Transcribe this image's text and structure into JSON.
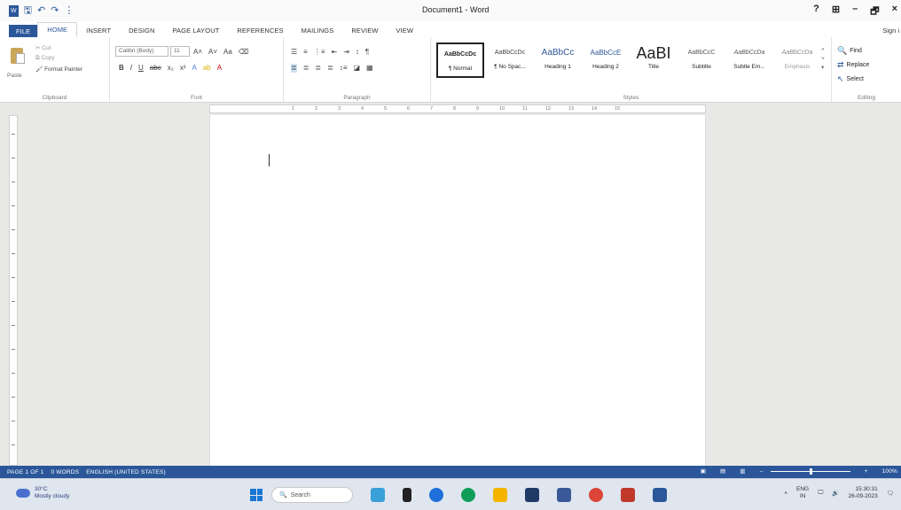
{
  "window": {
    "title": "Document1 - Word"
  },
  "qat": {
    "save": "🖫",
    "undo": "↶",
    "redo": "↷",
    "more": "⋮"
  },
  "window_controls": {
    "help": "?",
    "ribbon_opts": "⊞",
    "minimize": "–",
    "maximize": "🗗",
    "close": "×"
  },
  "signin": "Sign i",
  "tabs": [
    "FILE",
    "HOME",
    "INSERT",
    "DESIGN",
    "PAGE LAYOUT",
    "REFERENCES",
    "MAILINGS",
    "REVIEW",
    "VIEW"
  ],
  "ribbon": {
    "clipboard": {
      "label": "Clipboard",
      "paste": "Paste",
      "cut": "Cut",
      "copy": "Copy",
      "painter": "Format Painter"
    },
    "font": {
      "label": "Font",
      "name": "Calibri (Body)",
      "size": "11"
    },
    "paragraph": {
      "label": "Paragraph"
    },
    "styles": {
      "label": "Styles",
      "items": [
        {
          "preview": "AaBbCcDc",
          "name": "¶ Normal"
        },
        {
          "preview": "AaBbCcDc",
          "name": "¶ No Spac..."
        },
        {
          "preview": "AaBbCc",
          "name": "Heading 1"
        },
        {
          "preview": "AaBbCcE",
          "name": "Heading 2"
        },
        {
          "preview": "AaBI",
          "name": "Title"
        },
        {
          "preview": "AaBbCcC",
          "name": "Subtitle"
        },
        {
          "preview": "AaBbCcDa",
          "name": "Subtle Em..."
        },
        {
          "preview": "AaBbCcDa",
          "name": "Emphasis"
        }
      ]
    },
    "editing": {
      "label": "Editing",
      "find": "Find",
      "replace": "Replace",
      "select": "Select"
    }
  },
  "ruler_numbers": [
    "1",
    "2",
    "3",
    "4",
    "5",
    "6",
    "7",
    "8",
    "9",
    "10",
    "11",
    "12",
    "13",
    "14",
    "15"
  ],
  "status": {
    "page": "PAGE 1 OF 1",
    "words": "0 WORDS",
    "language": "ENGLISH (UNITED STATES)",
    "zoom": "100%"
  },
  "taskbar": {
    "weather_temp": "30°C",
    "weather_desc": "Mostly cloudy",
    "search": "Search",
    "lang": "ENG",
    "lang2": "IN",
    "time": "15:30:31",
    "date": "26-09-2023"
  },
  "colors": {
    "accent": "#2b579a"
  }
}
